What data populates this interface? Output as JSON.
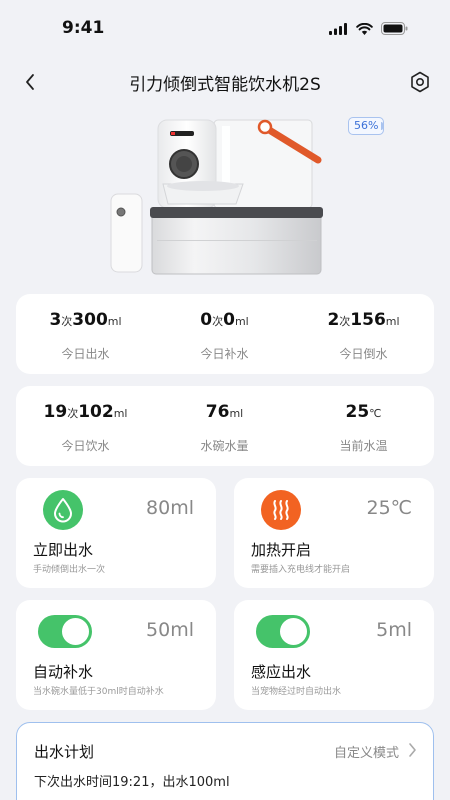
{
  "status_bar": {
    "time": "9:41"
  },
  "nav": {
    "title": "引力倾倒式智能饮水机2S"
  },
  "device": {
    "battery": "56%"
  },
  "stats_row1": [
    {
      "count": "3",
      "count_unit": "次",
      "amount": "300",
      "amount_unit": "ml",
      "label": "今日出水"
    },
    {
      "count": "0",
      "count_unit": "次",
      "amount": "0",
      "amount_unit": "ml",
      "label": "今日补水"
    },
    {
      "count": "2",
      "count_unit": "次",
      "amount": "156",
      "amount_unit": "ml",
      "label": "今日倒水"
    }
  ],
  "stats_row2": [
    {
      "count": "19",
      "count_unit": "次",
      "amount": "102",
      "amount_unit": "ml",
      "label": "今日饮水"
    },
    {
      "amount": "76",
      "amount_unit": "ml",
      "label": "水碗水量"
    },
    {
      "amount": "25",
      "amount_unit": "℃",
      "label": "当前水温"
    }
  ],
  "features": {
    "dispense": {
      "title": "立即出水",
      "subtitle": "手动倾倒出水一次",
      "value": "80ml",
      "icon": "water-drop-icon",
      "color": "#45c36a"
    },
    "heating": {
      "title": "加热开启",
      "subtitle": "需要插入充电线才能开启",
      "value": "25℃",
      "icon": "heat-waves-icon",
      "color": "#f26322"
    },
    "auto_refill": {
      "title": "自动补水",
      "subtitle": "当水碗水量低于30ml时自动补水",
      "value": "50ml",
      "enabled": true
    },
    "sensor_dispense": {
      "title": "感应出水",
      "subtitle": "当宠物经过时自动出水",
      "value": "5ml",
      "enabled": true
    }
  },
  "plan": {
    "title": "出水计划",
    "mode": "自定义模式",
    "next": "下次出水时间19:21，出水100ml"
  }
}
